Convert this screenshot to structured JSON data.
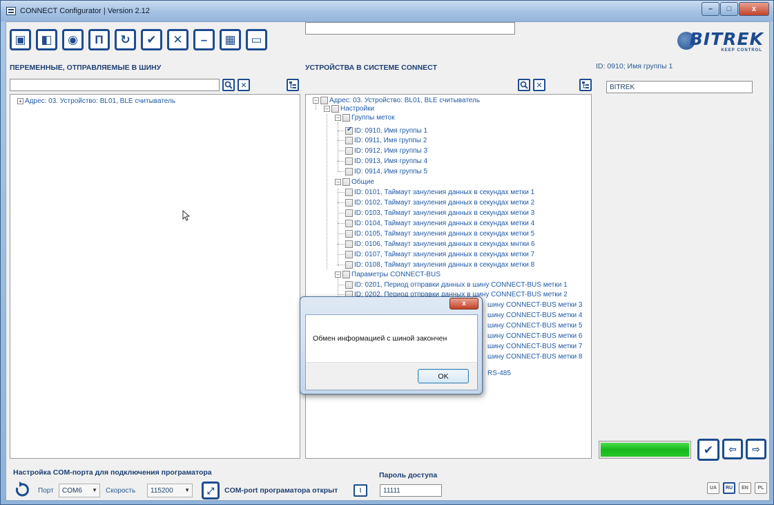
{
  "window": {
    "title": "CONNECT Configurator | Version 2.12",
    "min": "–",
    "max": "□",
    "close": "x"
  },
  "toolbar": {
    "buttons": [
      {
        "icon": "open-window-icon",
        "glyph": "▣"
      },
      {
        "icon": "import-icon",
        "glyph": "◧"
      },
      {
        "icon": "eye-icon",
        "glyph": "◉"
      },
      {
        "icon": "bracket-icon",
        "glyph": "Π"
      },
      {
        "icon": "refresh-icon",
        "glyph": "↻"
      },
      {
        "icon": "check-icon",
        "glyph": "✔"
      },
      {
        "icon": "close-icon",
        "glyph": "✕"
      },
      {
        "icon": "minus-icon",
        "glyph": "–"
      },
      {
        "icon": "chip-icon",
        "glyph": "▦"
      },
      {
        "icon": "monitor-icon",
        "glyph": "▭"
      }
    ]
  },
  "logo": {
    "brand": "BITREK",
    "tag": "KEEP CONTROL"
  },
  "left": {
    "heading": "ПЕРЕМЕННЫЕ, ОТПРАВЛЯЕМЫЕ В ШИНУ",
    "search_value": "",
    "tree": [
      {
        "label": "Адрес: 03. Устройство: BL01, BLE считыватель"
      }
    ]
  },
  "middle": {
    "heading": "УСТРОЙСТВА В СИСТЕМЕ CONNECT",
    "search_value": "",
    "tree": {
      "root": "Адрес: 03. Устройство: BL01, BLE считыватель",
      "settings": "Настройки",
      "groups_label": "Группы меток",
      "groups": [
        {
          "label": "ID: 0910, Имя группы 1",
          "checked": true
        },
        {
          "label": "ID: 0911, Имя группы 2",
          "checked": false
        },
        {
          "label": "ID: 0912, Имя группы 3",
          "checked": false
        },
        {
          "label": "ID: 0913, Имя группы 4",
          "checked": false
        },
        {
          "label": "ID: 0914, Имя группы 5",
          "checked": false
        }
      ],
      "general_label": "Общие",
      "general": [
        "ID: 0101, Таймаут зануления данных в секундах метки 1",
        "ID: 0102, Таймаут зануления данных в секундах метки 2",
        "ID: 0103, Таймаут зануления данных в секундах метки 3",
        "ID: 0104, Таймаут зануления данных в секундах метки 4",
        "ID: 0105, Таймаут зануления данных в секундах метки 5",
        "ID: 0106, Таймаут зануления данных в секундах мнтки 6",
        "ID: 0107, Таймаут зануления данных в секундах метки 7",
        "ID: 0108, Таймаут зануления данных в секундах метки 8"
      ],
      "bus_label": "Параметры CONNECT-BUS",
      "bus": [
        "ID: 0201, Период отправки данных в шину CONNECT-BUS метки 1",
        "ID: 0202, Период отправки данных в шину CONNECT-BUS метки 2"
      ],
      "bus_partial": [
        "шину CONNECT-BUS метки 3",
        "шину CONNECT-BUS метки 4",
        "шину CONNECT-BUS метки 5",
        "шину CONNECT-BUS метки 6",
        "шину CONNECT-BUS метки 7",
        "шину CONNECT-BUS метки 8"
      ],
      "rs_partial": "RS-485"
    }
  },
  "right": {
    "id_label": "ID: 0910; Имя группы 1",
    "name_value": "BITREK",
    "progress": 1.0
  },
  "dialog": {
    "message": "Обмен информацией с шиной закончен",
    "ok": "OK",
    "close": "x"
  },
  "bottom": {
    "com_heading": "Настройка COM-порта для подключения програматора",
    "port_label": "Порт",
    "port_value": "COM6",
    "speed_label": "Скорость",
    "speed_value": "115200",
    "status": "COM-port програматора открыт",
    "password_heading": "Пароль доступа",
    "password_value": "11111",
    "languages": [
      {
        "code": "UA",
        "active": false
      },
      {
        "code": "RU",
        "active": true
      },
      {
        "code": "EN",
        "active": false
      },
      {
        "code": "PL",
        "active": false
      }
    ]
  },
  "colors": {
    "accent": "#1d4c8f",
    "tree_text": "#1f5aa8",
    "progress": "#16b81a"
  }
}
